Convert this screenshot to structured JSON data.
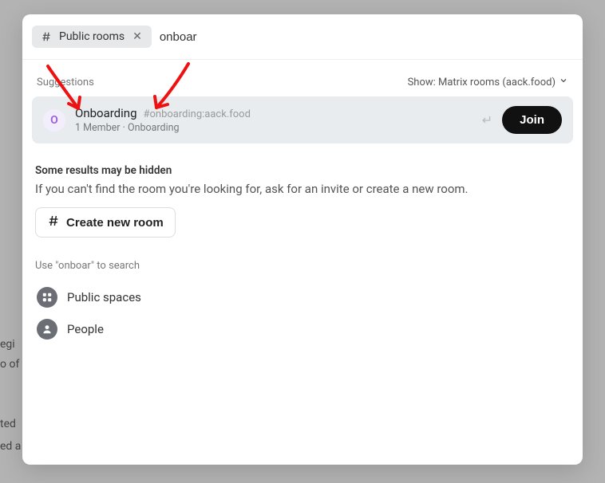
{
  "bg": {
    "line1": "egi",
    "line2": "o of",
    "line3": "ted",
    "line4": "ed a"
  },
  "search": {
    "chip_label": "Public rooms",
    "value": "onboar"
  },
  "suggestions": {
    "label": "Suggestions",
    "filter_label": "Show: Matrix rooms (aack.food)"
  },
  "result": {
    "avatar_letter": "O",
    "title": "Onboarding",
    "alias": "#onboarding:aack.food",
    "subtitle": "1 Member · Onboarding",
    "enter_hint": "↵",
    "join_label": "Join"
  },
  "hidden": {
    "title": "Some results may be hidden",
    "text": "If you can't find the room you're looking for, ask for an invite or create a new room.",
    "create_label": "Create new room"
  },
  "use_search": {
    "label": "Use \"onboar\" to search",
    "option_spaces": "Public spaces",
    "option_people": "People"
  }
}
